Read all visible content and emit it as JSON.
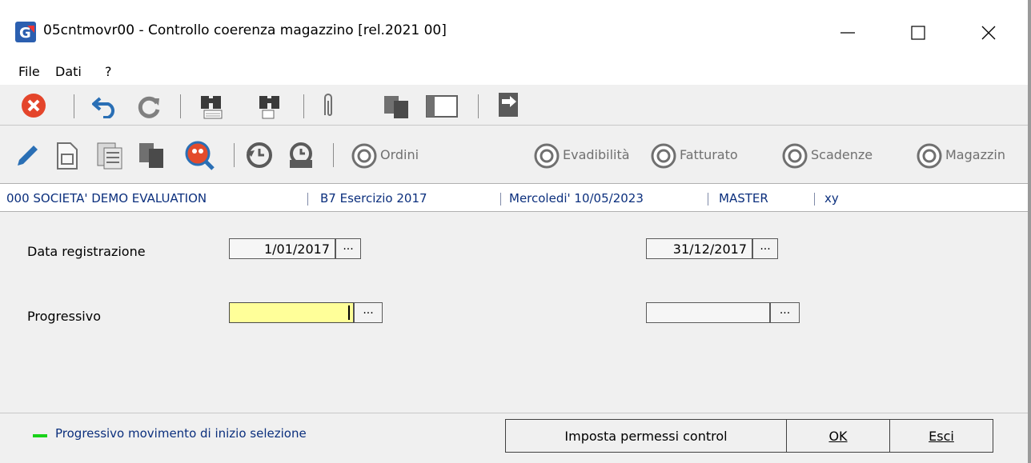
{
  "window": {
    "title": "05cntmovr00 - Controllo coerenza magazzino  [rel.2021 00]",
    "app_icon": "G-app-icon",
    "controls": [
      "minimize-icon",
      "maximize-icon",
      "close-icon"
    ]
  },
  "menu": {
    "items": [
      "File",
      "Dati",
      "?"
    ]
  },
  "toolbar2": {
    "links": [
      "Ordini",
      "Evadibilità",
      "Fatturato",
      "Scadenze",
      "Magazzin"
    ]
  },
  "infobar": {
    "company": "000 SOCIETA'  DEMO EVALUATION",
    "exercise": "B7 Esercizio 2017",
    "date": "Mercoledi' 10/05/2023",
    "user": "MASTER",
    "extra": "xy"
  },
  "form": {
    "data_label": "Data registrazione",
    "data_from": "1/01/2017",
    "data_to": "31/12/2017",
    "prog_label": "Progressivo",
    "prog_from": "",
    "prog_to": "",
    "ellipsis": "..."
  },
  "footer": {
    "hint": "Progressivo movimento di inizio selezione",
    "btn_permessi": "Imposta permessi control",
    "btn_ok": "OK",
    "btn_esci": "Esci"
  },
  "colors": {
    "info_text": "#0b2f7d",
    "active_field": "#ffff99",
    "hint_marker": "#19d219"
  }
}
